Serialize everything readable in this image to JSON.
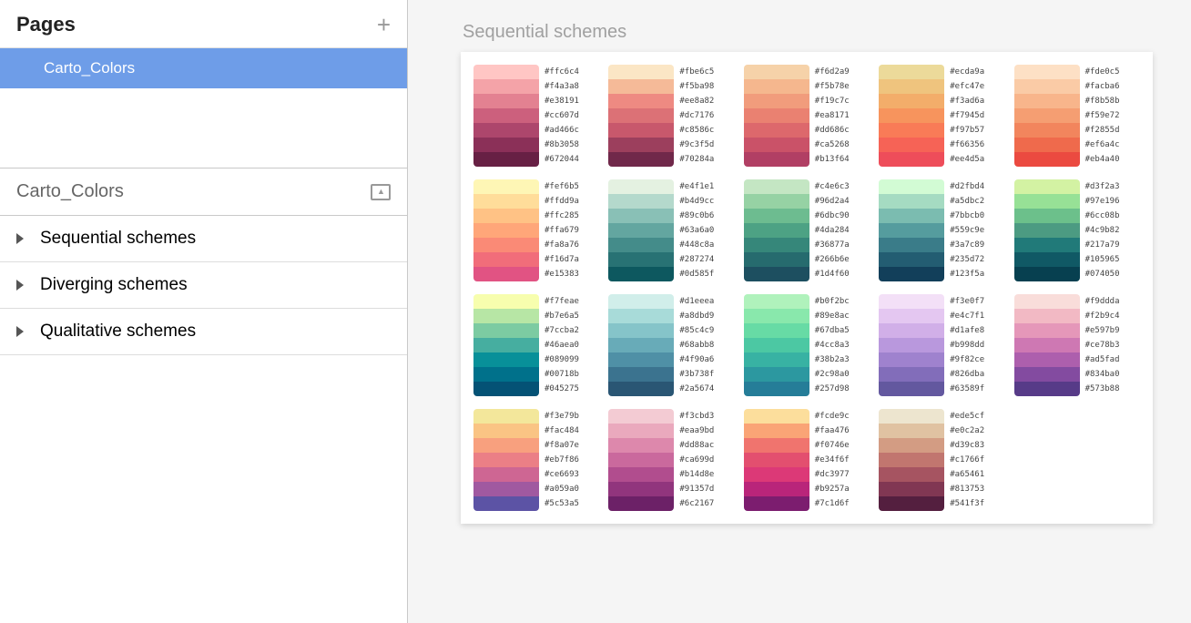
{
  "sidebar": {
    "pages_title": "Pages",
    "pages": [
      "Carto_Colors"
    ],
    "layers_title": "Carto_Colors",
    "layers": [
      "Sequential schemes",
      "Diverging schemes",
      "Qualitative schemes"
    ]
  },
  "canvas": {
    "title": "Sequential schemes"
  },
  "palettes": [
    [
      "#ffc6c4",
      "#f4a3a8",
      "#e38191",
      "#cc607d",
      "#ad466c",
      "#8b3058",
      "#672044"
    ],
    [
      "#fbe6c5",
      "#f5ba98",
      "#ee8a82",
      "#dc7176",
      "#c8586c",
      "#9c3f5d",
      "#70284a"
    ],
    [
      "#f6d2a9",
      "#f5b78e",
      "#f19c7c",
      "#ea8171",
      "#dd686c",
      "#ca5268",
      "#b13f64"
    ],
    [
      "#ecda9a",
      "#efc47e",
      "#f3ad6a",
      "#f7945d",
      "#f97b57",
      "#f66356",
      "#ee4d5a"
    ],
    [
      "#fde0c5",
      "#facba6",
      "#f8b58b",
      "#f59e72",
      "#f2855d",
      "#ef6a4c",
      "#eb4a40"
    ],
    [
      "#fef6b5",
      "#ffdd9a",
      "#ffc285",
      "#ffa679",
      "#fa8a76",
      "#f16d7a",
      "#e15383"
    ],
    [
      "#e4f1e1",
      "#b4d9cc",
      "#89c0b6",
      "#63a6a0",
      "#448c8a",
      "#287274",
      "#0d585f"
    ],
    [
      "#c4e6c3",
      "#96d2a4",
      "#6dbc90",
      "#4da284",
      "#36877a",
      "#266b6e",
      "#1d4f60"
    ],
    [
      "#d2fbd4",
      "#a5dbc2",
      "#7bbcb0",
      "#559c9e",
      "#3a7c89",
      "#235d72",
      "#123f5a"
    ],
    [
      "#d3f2a3",
      "#97e196",
      "#6cc08b",
      "#4c9b82",
      "#217a79",
      "#105965",
      "#074050"
    ],
    [
      "#f7feae",
      "#b7e6a5",
      "#7ccba2",
      "#46aea0",
      "#089099",
      "#00718b",
      "#045275"
    ],
    [
      "#d1eeea",
      "#a8dbd9",
      "#85c4c9",
      "#68abb8",
      "#4f90a6",
      "#3b738f",
      "#2a5674"
    ],
    [
      "#b0f2bc",
      "#89e8ac",
      "#67dba5",
      "#4cc8a3",
      "#38b2a3",
      "#2c98a0",
      "#257d98"
    ],
    [
      "#f3e0f7",
      "#e4c7f1",
      "#d1afe8",
      "#b998dd",
      "#9f82ce",
      "#826dba",
      "#63589f"
    ],
    [
      "#f9ddda",
      "#f2b9c4",
      "#e597b9",
      "#ce78b3",
      "#ad5fad",
      "#834ba0",
      "#573b88"
    ],
    [
      "#f3e79b",
      "#fac484",
      "#f8a07e",
      "#eb7f86",
      "#ce6693",
      "#a059a0",
      "#5c53a5"
    ],
    [
      "#f3cbd3",
      "#eaa9bd",
      "#dd88ac",
      "#ca699d",
      "#b14d8e",
      "#91357d",
      "#6c2167"
    ],
    [
      "#fcde9c",
      "#faa476",
      "#f0746e",
      "#e34f6f",
      "#dc3977",
      "#b9257a",
      "#7c1d6f"
    ],
    [
      "#ede5cf",
      "#e0c2a2",
      "#d39c83",
      "#c1766f",
      "#a65461",
      "#813753",
      "#541f3f"
    ]
  ]
}
